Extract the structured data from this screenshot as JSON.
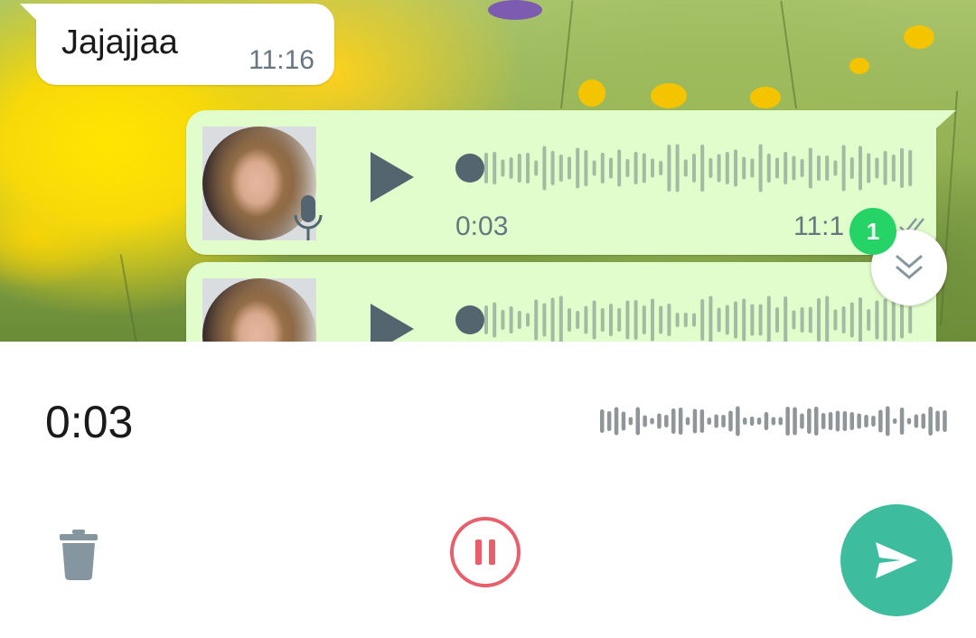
{
  "messages": {
    "incoming": {
      "text": "Jajajjaa",
      "time": "11:16"
    },
    "voice_notes": [
      {
        "duration": "0:03",
        "time": "11:1"
      },
      {
        "duration": "",
        "time": ""
      }
    ]
  },
  "unread_badge": "1",
  "recording": {
    "timer": "0:03"
  },
  "icons": {
    "play": "play-icon",
    "mic": "microphone-icon",
    "ticks": "double-check-icon",
    "scroll": "double-chevron-down-icon",
    "delete": "trash-icon",
    "pause": "pause-icon",
    "send": "send-icon"
  },
  "colors": {
    "outgoing_bubble": "#e1fdcb",
    "badge": "#25d366",
    "send_button": "#3ebd9e",
    "pause_ring": "#ea5e6c",
    "icon_gray": "#54656f"
  }
}
